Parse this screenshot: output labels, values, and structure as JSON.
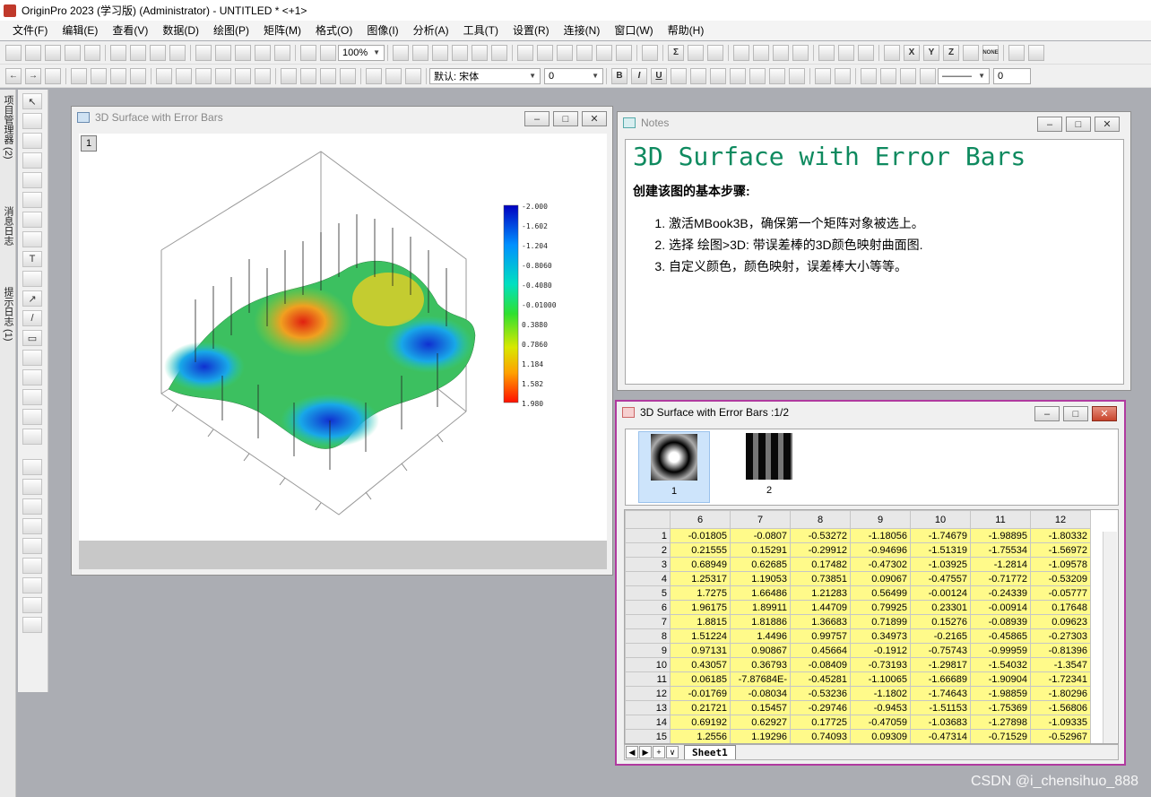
{
  "app": {
    "title": "OriginPro 2023 (学习版) (Administrator) - UNTITLED * <+1>"
  },
  "menu": [
    "文件(F)",
    "编辑(E)",
    "查看(V)",
    "数据(D)",
    "绘图(P)",
    "矩阵(M)",
    "格式(O)",
    "图像(I)",
    "分析(A)",
    "工具(T)",
    "设置(R)",
    "连接(N)",
    "窗口(W)",
    "帮助(H)"
  ],
  "toolbar": {
    "zoom": "100%",
    "font": "默认: 宋体",
    "font_size": "0",
    "line_width": "0",
    "none_label": "NONE"
  },
  "left_dock": [
    "项目管理器 (2)",
    "消息日志",
    "提示日志 (1)"
  ],
  "graph_window": {
    "title": "3D Surface with Error Bars",
    "layer": "1",
    "colorbar_labels": [
      "-2.000",
      "-1.602",
      "-1.204",
      "-0.8060",
      "-0.4080",
      "-0.01000",
      "0.3880",
      "0.7860",
      "1.184",
      "1.582",
      "1.980"
    ]
  },
  "notes_window": {
    "title": "Notes",
    "heading": "3D Surface with Error Bars",
    "subheading": "创建该图的基本步骤:",
    "steps": [
      "激活MBook3B，确保第一个矩阵对象被选上。",
      "选择 绘图>3D: 带误差棒的3D颜色映射曲面图.",
      "自定义颜色，颜色映射，误差棒大小等等。"
    ]
  },
  "workbook": {
    "title": "3D Surface with Error Bars :1/2",
    "thumbnails": [
      "1",
      "2"
    ],
    "columns": [
      "6",
      "7",
      "8",
      "9",
      "10",
      "11",
      "12"
    ],
    "rows": [
      [
        "1",
        "-0.01805",
        "-0.0807",
        "-0.53272",
        "-1.18056",
        "-1.74679",
        "-1.98895",
        "-1.80332"
      ],
      [
        "2",
        "0.21555",
        "0.15291",
        "-0.29912",
        "-0.94696",
        "-1.51319",
        "-1.75534",
        "-1.56972"
      ],
      [
        "3",
        "0.68949",
        "0.62685",
        "0.17482",
        "-0.47302",
        "-1.03925",
        "-1.2814",
        "-1.09578"
      ],
      [
        "4",
        "1.25317",
        "1.19053",
        "0.73851",
        "0.09067",
        "-0.47557",
        "-0.71772",
        "-0.53209"
      ],
      [
        "5",
        "1.7275",
        "1.66486",
        "1.21283",
        "0.56499",
        "-0.00124",
        "-0.24339",
        "-0.05777"
      ],
      [
        "6",
        "1.96175",
        "1.89911",
        "1.44709",
        "0.79925",
        "0.23301",
        "-0.00914",
        "0.17648"
      ],
      [
        "7",
        "1.8815",
        "1.81886",
        "1.36683",
        "0.71899",
        "0.15276",
        "-0.08939",
        "0.09623"
      ],
      [
        "8",
        "1.51224",
        "1.4496",
        "0.99757",
        "0.34973",
        "-0.2165",
        "-0.45865",
        "-0.27303"
      ],
      [
        "9",
        "0.97131",
        "0.90867",
        "0.45664",
        "-0.1912",
        "-0.75743",
        "-0.99959",
        "-0.81396"
      ],
      [
        "10",
        "0.43057",
        "0.36793",
        "-0.08409",
        "-0.73193",
        "-1.29817",
        "-1.54032",
        "-1.3547"
      ],
      [
        "11",
        "0.06185",
        "-7.87684E-",
        "-0.45281",
        "-1.10065",
        "-1.66689",
        "-1.90904",
        "-1.72341"
      ],
      [
        "12",
        "-0.01769",
        "-0.08034",
        "-0.53236",
        "-1.1802",
        "-1.74643",
        "-1.98859",
        "-1.80296"
      ],
      [
        "13",
        "0.21721",
        "0.15457",
        "-0.29746",
        "-0.9453",
        "-1.51153",
        "-1.75369",
        "-1.56806"
      ],
      [
        "14",
        "0.69192",
        "0.62927",
        "0.17725",
        "-0.47059",
        "-1.03683",
        "-1.27898",
        "-1.09335"
      ],
      [
        "15",
        "1.2556",
        "1.19296",
        "0.74093",
        "0.09309",
        "-0.47314",
        "-0.71529",
        "-0.52967"
      ]
    ],
    "sheet_tab": "Sheet1"
  },
  "watermark": "CSDN @i_chensihuo_888",
  "colors": {
    "accent_book_border": "#b03a9f",
    "notes_heading": "#0e8a5f",
    "cell_fill": "#fffa8a"
  }
}
